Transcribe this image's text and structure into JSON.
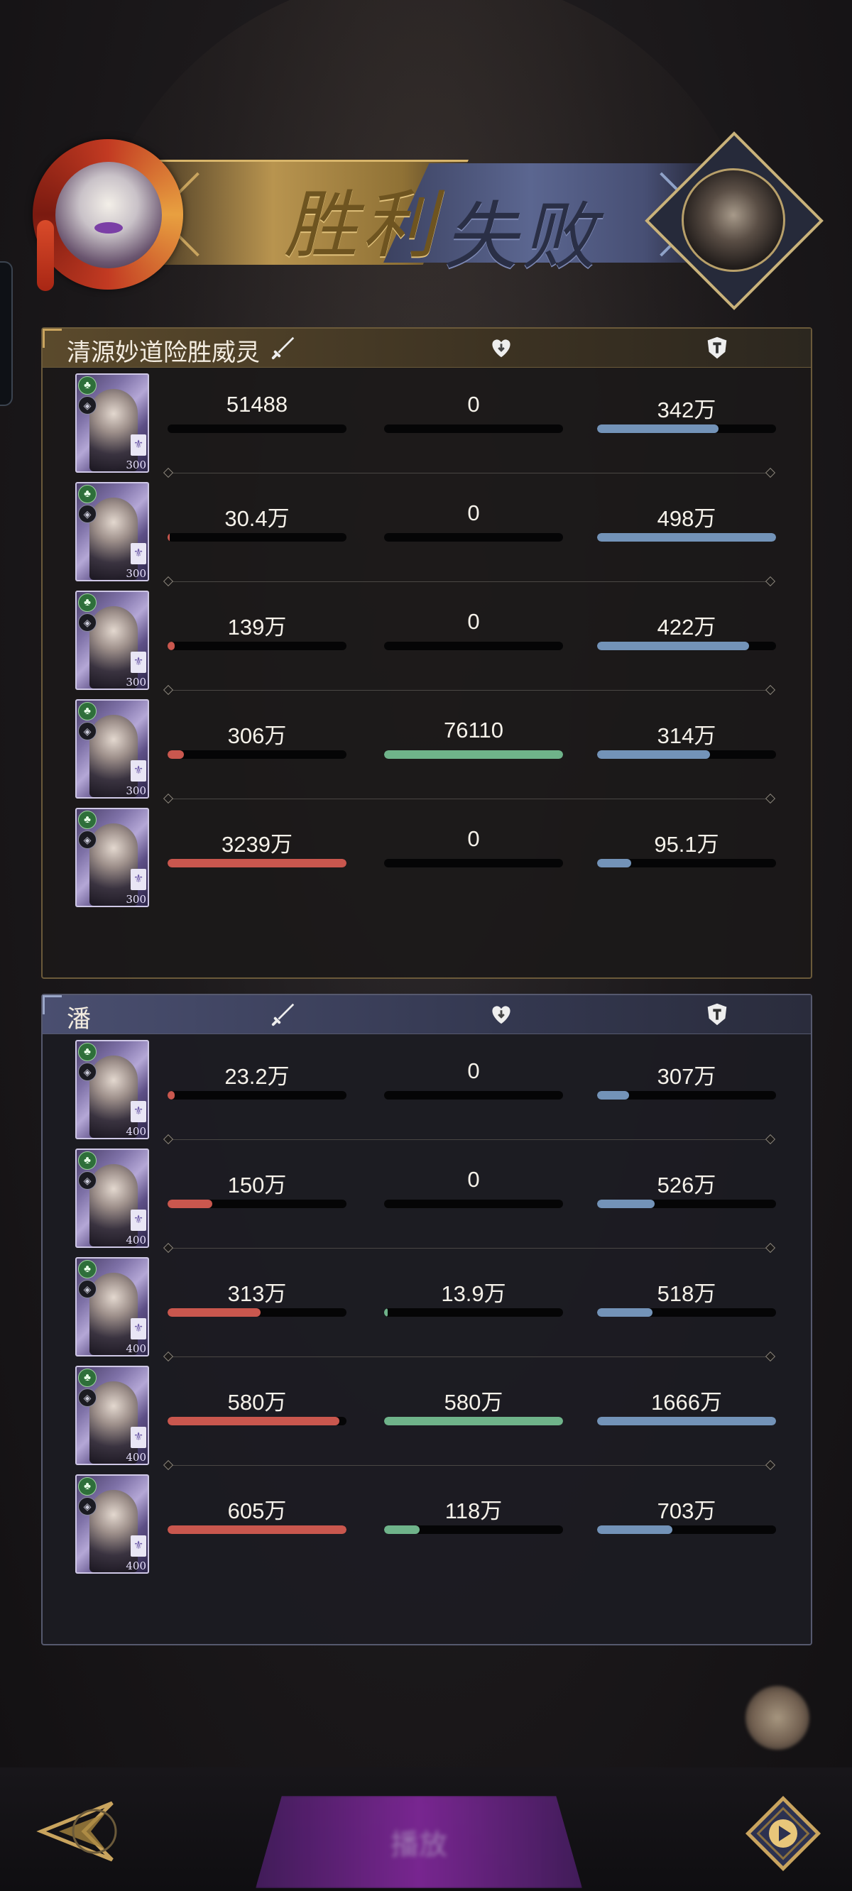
{
  "header": {
    "win_label": "胜利",
    "lose_label": "失败"
  },
  "teams": [
    {
      "name": "清源妙道险胜威灵",
      "rows": [
        {
          "level": "300",
          "damage": "51488",
          "damage_pct": 0.0,
          "heal": "0",
          "heal_pct": 0.0,
          "tank": "342万",
          "tank_pct": 0.68
        },
        {
          "level": "300",
          "damage": "30.4万",
          "damage_pct": 0.01,
          "heal": "0",
          "heal_pct": 0.0,
          "tank": "498万",
          "tank_pct": 1.0
        },
        {
          "level": "300",
          "damage": "139万",
          "damage_pct": 0.04,
          "heal": "0",
          "heal_pct": 0.0,
          "tank": "422万",
          "tank_pct": 0.85
        },
        {
          "level": "300",
          "damage": "306万",
          "damage_pct": 0.09,
          "heal": "76110",
          "heal_pct": 1.0,
          "tank": "314万",
          "tank_pct": 0.63
        },
        {
          "level": "300",
          "damage": "3239万",
          "damage_pct": 1.0,
          "heal": "0",
          "heal_pct": 0.0,
          "tank": "95.1万",
          "tank_pct": 0.19
        }
      ]
    },
    {
      "name": "潘",
      "rows": [
        {
          "level": "400",
          "damage": "23.2万",
          "damage_pct": 0.04,
          "heal": "0",
          "heal_pct": 0.0,
          "tank": "307万",
          "tank_pct": 0.18
        },
        {
          "level": "400",
          "damage": "150万",
          "damage_pct": 0.25,
          "heal": "0",
          "heal_pct": 0.0,
          "tank": "526万",
          "tank_pct": 0.32
        },
        {
          "level": "400",
          "damage": "313万",
          "damage_pct": 0.52,
          "heal": "13.9万",
          "heal_pct": 0.02,
          "tank": "518万",
          "tank_pct": 0.31
        },
        {
          "level": "400",
          "damage": "580万",
          "damage_pct": 0.96,
          "heal": "580万",
          "heal_pct": 1.0,
          "tank": "1666万",
          "tank_pct": 1.0
        },
        {
          "level": "400",
          "damage": "605万",
          "damage_pct": 1.0,
          "heal": "118万",
          "heal_pct": 0.2,
          "tank": "703万",
          "tank_pct": 0.42
        }
      ]
    }
  ],
  "icons": {
    "damage": "sword-icon",
    "heal": "heart-icon",
    "tank": "shield-icon",
    "back": "back-arrow-icon",
    "replay": "replay-icon"
  },
  "colors": {
    "damage_bar": "#c9574e",
    "heal_bar": "#6fb38a",
    "tank_bar": "#7393b8",
    "win_gold": "#b8944f",
    "lose_blue": "#5b6690"
  }
}
